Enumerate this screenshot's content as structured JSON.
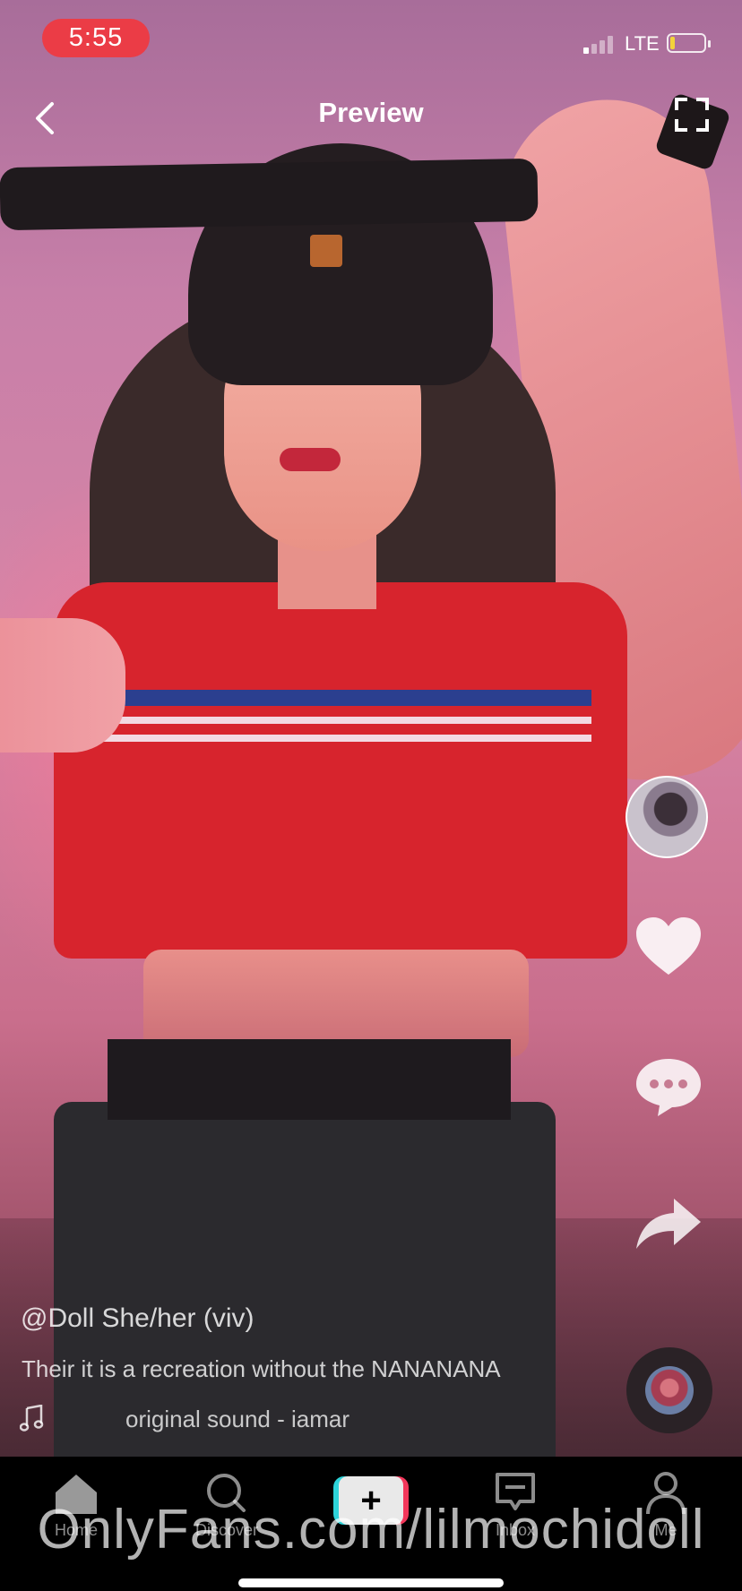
{
  "status_bar": {
    "time": "5:55",
    "network": "LTE",
    "battery_color": "#f3d33a",
    "time_pill_color": "#eb3c46"
  },
  "header": {
    "title": "Preview",
    "back_icon": "chevron-left-icon",
    "fullscreen_icon": "fullscreen-icon"
  },
  "right_rail": {
    "profile": "profile-avatar",
    "like_icon": "heart-icon",
    "comment_icon": "comment-bubble-icon",
    "share_icon": "share-arrow-icon",
    "sound_disc": "sound-disc-icon"
  },
  "caption": {
    "username": "@Doll She/her (viv)",
    "text": "Their it is a recreation without the NANANANA",
    "sound": "original sound - iamar"
  },
  "nav": {
    "items": [
      {
        "label": "Home",
        "icon": "home-icon"
      },
      {
        "label": "Discover",
        "icon": "search-icon"
      },
      {
        "label": "",
        "icon": "plus-icon"
      },
      {
        "label": "Inbox",
        "icon": "inbox-icon"
      },
      {
        "label": "Me",
        "icon": "person-icon"
      }
    ]
  },
  "watermark": "OnlyFans.com/lilmochidoll"
}
